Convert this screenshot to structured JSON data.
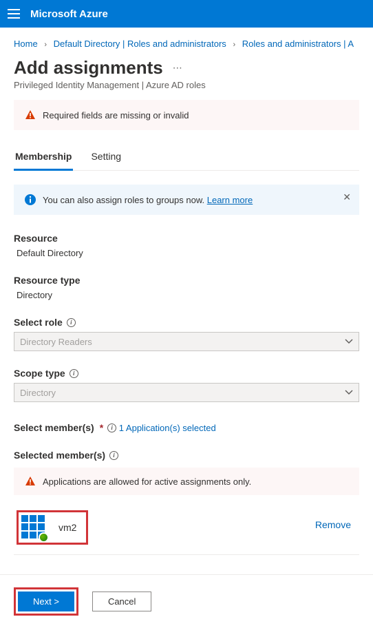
{
  "header": {
    "brand": "Microsoft Azure"
  },
  "breadcrumb": {
    "items": [
      "Home",
      "Default Directory | Roles and administrators",
      "Roles and administrators | A"
    ]
  },
  "page": {
    "title": "Add assignments",
    "subtitle": "Privileged Identity Management | Azure AD roles"
  },
  "banner_required": "Required fields are missing or invalid",
  "tabs": {
    "membership": "Membership",
    "setting": "Setting"
  },
  "info_banner": {
    "text": "You can also assign roles to groups now. ",
    "link": "Learn more"
  },
  "fields": {
    "resource_label": "Resource",
    "resource_value": "Default Directory",
    "resource_type_label": "Resource type",
    "resource_type_value": "Directory",
    "select_role_label": "Select role",
    "select_role_value": "Directory Readers",
    "scope_type_label": "Scope type",
    "scope_type_value": "Directory",
    "select_members_label": "Select member(s)",
    "select_members_link": "1 Application(s) selected",
    "selected_members_label": "Selected member(s)"
  },
  "banner_app_only": "Applications are allowed for active assignments only.",
  "member": {
    "name": "vm2",
    "remove": "Remove"
  },
  "footer": {
    "next": "Next >",
    "cancel": "Cancel"
  }
}
